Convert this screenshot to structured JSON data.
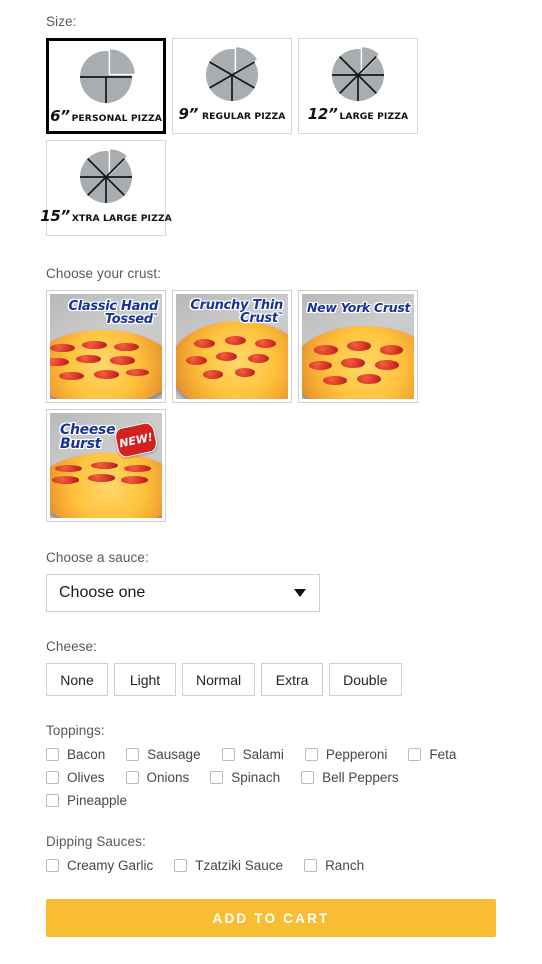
{
  "sizes": {
    "label": "Size:",
    "options": [
      {
        "inches": "6”",
        "name": "PERSONAL PIZZA",
        "slices": 4,
        "selected": true
      },
      {
        "inches": "9”",
        "name": "REGULAR PIZZA",
        "slices": 6,
        "selected": false
      },
      {
        "inches": "12”",
        "name": "LARGE PIZZA",
        "slices": 8,
        "selected": false
      },
      {
        "inches": "15”",
        "name": "XTRA LARGE PIZZA",
        "slices": 8,
        "selected": false
      }
    ]
  },
  "crust": {
    "label": "Choose your crust:",
    "options": [
      {
        "name": "Classic Hand Tossed",
        "line1": "Classic Hand",
        "line2": "Tossed",
        "trademark": "™",
        "badge": "",
        "selected": false
      },
      {
        "name": "Crunchy Thin Crust",
        "line1": "Crunchy Thin",
        "line2": "Crust",
        "trademark": "™",
        "badge": "",
        "selected": false
      },
      {
        "name": "New York Crust",
        "line1": "New York Crust",
        "line2": "",
        "trademark": "",
        "badge": "",
        "selected": false
      },
      {
        "name": "Cheese Burst",
        "line1": "Cheese",
        "line2": "Burst",
        "trademark": "",
        "badge": "NEW!",
        "selected": false
      }
    ]
  },
  "sauce": {
    "label": "Choose a sauce:",
    "selected": "Choose one",
    "icon": "chevron-down-icon"
  },
  "cheese": {
    "label": "Cheese:",
    "options": [
      "None",
      "Light",
      "Normal",
      "Extra",
      "Double"
    ],
    "selected": ""
  },
  "toppings": {
    "label": "Toppings:",
    "rows": [
      [
        "Bacon",
        "Sausage",
        "Salami",
        "Pepperoni",
        "Feta"
      ],
      [
        "Olives",
        "Onions",
        "Spinach",
        "Bell Peppers"
      ],
      [
        "Pineapple"
      ]
    ]
  },
  "dipping_sauces": {
    "label": "Dipping Sauces:",
    "rows": [
      [
        "Creamy Garlic",
        "Tzatziki Sauce",
        "Ranch"
      ]
    ]
  },
  "cta": {
    "label": "ADD TO CART",
    "color": "#f9bd33",
    "text_color": "#ffffff"
  }
}
